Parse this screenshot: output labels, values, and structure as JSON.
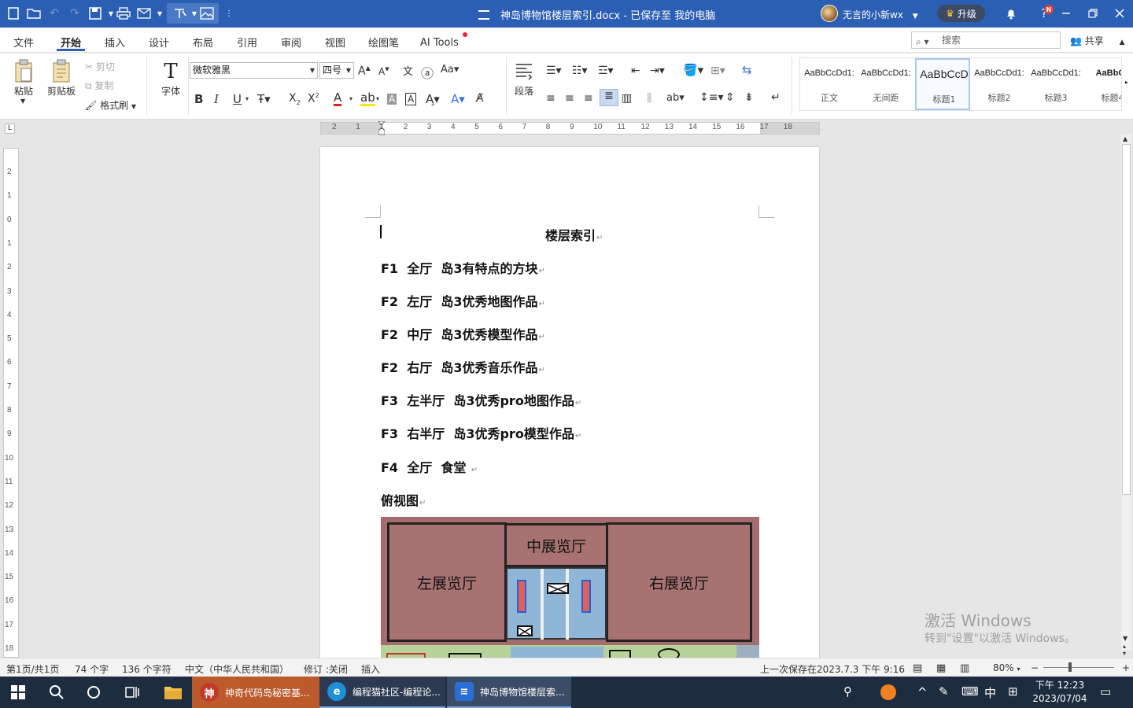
{
  "titlebar": {
    "document_title": "神岛博物馆楼层索引.docx - 已保存至 我的电脑",
    "username": "无言的小新wx",
    "upgrade_label": "升级",
    "notification_badge": "N"
  },
  "menu": {
    "items": [
      "文件",
      "开始",
      "插入",
      "设计",
      "布局",
      "引用",
      "审阅",
      "视图",
      "绘图笔",
      "AI Tools"
    ],
    "active": "开始",
    "search_placeholder": "搜索",
    "share_label": "共享"
  },
  "ribbon": {
    "paste_label": "粘贴",
    "clipboard_label": "剪贴板",
    "cut_label": "剪切",
    "copy_label": "复制",
    "format_painter_label": "格式刷",
    "font_label": "字体",
    "font_name": "微软雅黑",
    "font_size": "四号",
    "paragraph_label": "段落",
    "styles": [
      {
        "sample": "AaBbCcDd1:",
        "name": "正文"
      },
      {
        "sample": "AaBbCcDd1:",
        "name": "无间距"
      },
      {
        "sample": "AaBbCcD",
        "name": "标题1"
      },
      {
        "sample": "AaBbCcDd1:",
        "name": "标题2"
      },
      {
        "sample": "AaBbCcDd1:",
        "name": "标题3"
      },
      {
        "sample": "AaBbCc",
        "name": "标题4"
      }
    ],
    "selected_style": "标题1"
  },
  "ruler": {
    "horizontal": [
      "2",
      "1",
      "1",
      "2",
      "3",
      "4",
      "5",
      "6",
      "7",
      "8",
      "9",
      "10",
      "11",
      "12",
      "13",
      "14",
      "15",
      "16",
      "17",
      "18"
    ],
    "vertical": [
      "2",
      "1",
      "0",
      "1",
      "2",
      "3",
      "4",
      "5",
      "6",
      "7",
      "8",
      "9",
      "10",
      "11",
      "12",
      "13",
      "14",
      "15",
      "16",
      "17",
      "18"
    ]
  },
  "document": {
    "title": "楼层索引",
    "lines": [
      "F1  全厅  岛3有特点的方块",
      "F2  左厅  岛3优秀地图作品",
      "F2  中厅  岛3优秀模型作品",
      "F2  右厅  岛3优秀音乐作品",
      "F3  左半厅  岛3优秀pro地图作品",
      "F3  右半厅  岛3优秀pro模型作品",
      "F4  全厅  食堂 ",
      "俯视图"
    ],
    "paragraph_mark": "↵",
    "floorplan": {
      "left_hall": "左展览厅",
      "middle_hall": "中展览厅",
      "right_hall": "右展览厅"
    }
  },
  "watermark": {
    "line1": "激活 Windows",
    "line2": "转到\"设置\"以激活 Windows。"
  },
  "statusbar": {
    "page": "第1页/共1页",
    "words": "74 个字",
    "chars": "136 个字符",
    "language": "中文（中华人民共和国）",
    "track_changes": "修订 :关闭",
    "insert_mode": "插入",
    "last_saved": "上一次保存在2023.7.3 下午 9:16",
    "zoom": "80%"
  },
  "taskbar": {
    "apps": [
      {
        "label": "神奇代码岛秘密基...",
        "color": "#c0392b"
      },
      {
        "label": "编程猫社区-编程论...",
        "color": "#1f8fd6"
      },
      {
        "label": "神岛博物馆楼层索...",
        "color": "#2b6fd6"
      }
    ],
    "ime": "中",
    "time": "下午 12:23",
    "date": "2023/07/04"
  }
}
